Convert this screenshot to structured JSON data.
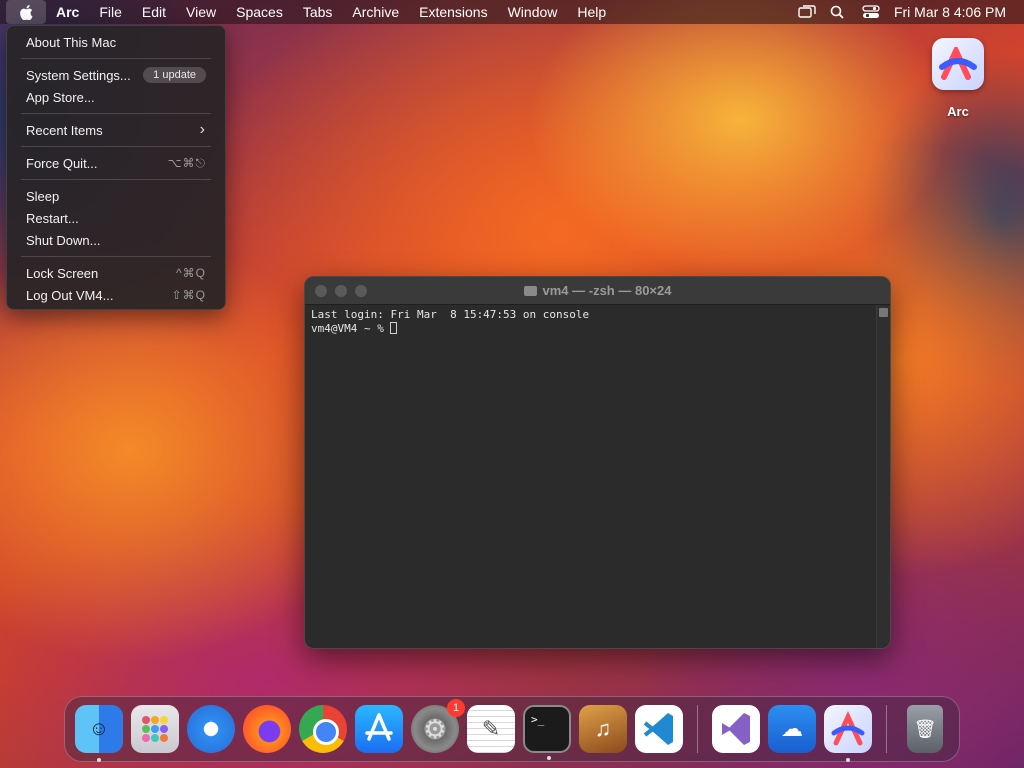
{
  "menubar": {
    "apple_icon": "apple-logo-icon",
    "app_name": "Arc",
    "items": [
      "File",
      "Edit",
      "View",
      "Spaces",
      "Tabs",
      "Archive",
      "Extensions",
      "Window",
      "Help"
    ],
    "status_icons": [
      "screen-mirroring-icon",
      "search-icon",
      "control-center-icon"
    ],
    "clock": "Fri Mar 8  4:06 PM"
  },
  "apple_menu": {
    "about": "About This Mac",
    "system_settings": "System Settings...",
    "update_badge": "1 update",
    "app_store": "App Store...",
    "recent_items": "Recent Items",
    "recent_items_arrow": "›",
    "force_quit": "Force Quit...",
    "force_quit_shortcut": "⌥⌘⎋",
    "sleep": "Sleep",
    "restart": "Restart...",
    "shut_down": "Shut Down...",
    "lock_screen": "Lock Screen",
    "lock_screen_shortcut": "^⌘Q",
    "log_out": "Log Out VM4...",
    "log_out_shortcut": "⇧⌘Q"
  },
  "desktop": {
    "arc_icon_label": "Arc"
  },
  "terminal": {
    "title": "vm4 — -zsh — 80×24",
    "line1": "Last login: Fri Mar  8 15:47:53 on console",
    "prompt": "vm4@VM4 ~ % "
  },
  "dock": {
    "items": [
      {
        "name": "finder",
        "running": true
      },
      {
        "name": "launchpad",
        "running": false
      },
      {
        "name": "safari",
        "running": false
      },
      {
        "name": "firefox",
        "running": false
      },
      {
        "name": "chrome",
        "running": false
      },
      {
        "name": "app-store",
        "running": false
      },
      {
        "name": "system-settings",
        "running": false,
        "badge": "1"
      },
      {
        "name": "textedit",
        "running": false
      },
      {
        "name": "terminal",
        "running": true
      },
      {
        "name": "garageband",
        "running": false
      },
      {
        "name": "vscode",
        "running": false
      },
      {
        "name": "visual-studio",
        "running": false
      },
      {
        "name": "weather",
        "running": false
      },
      {
        "name": "arc",
        "running": true
      },
      {
        "name": "trash",
        "running": false
      }
    ],
    "terminal_glyph": ">_",
    "settings_badge": "1"
  },
  "colors": {
    "badge_red": "#ff3b30",
    "menu_bg": "#282426",
    "terminal_bg": "#2b2b2b"
  }
}
